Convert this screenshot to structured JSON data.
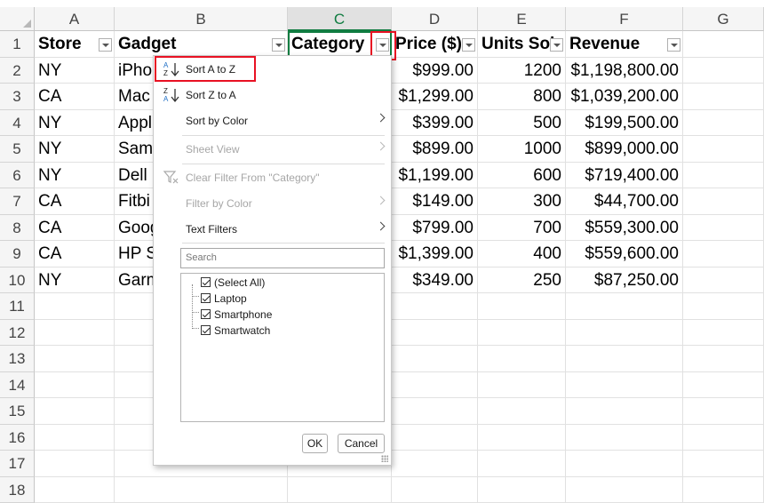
{
  "columns": [
    "A",
    "B",
    "C",
    "D",
    "E",
    "F",
    "G"
  ],
  "rows": [
    "1",
    "2",
    "3",
    "4",
    "5",
    "6",
    "7",
    "8",
    "9",
    "10",
    "11",
    "12",
    "13",
    "14",
    "15",
    "16",
    "17",
    "18"
  ],
  "headers": [
    "Store",
    "Gadget",
    "Category",
    "Price ($)",
    "Units Sol",
    "Revenue"
  ],
  "data": [
    {
      "store": "NY",
      "gadget": "iPho",
      "price": "$999.00",
      "units": "1200",
      "revenue": "$1,198,800.00"
    },
    {
      "store": "CA",
      "gadget": "Mac",
      "price": "$1,299.00",
      "units": "800",
      "revenue": "$1,039,200.00"
    },
    {
      "store": "NY",
      "gadget": "Appl",
      "price": "$399.00",
      "units": "500",
      "revenue": "$199,500.00"
    },
    {
      "store": "NY",
      "gadget": "Sams",
      "price": "$899.00",
      "units": "1000",
      "revenue": "$899,000.00"
    },
    {
      "store": "NY",
      "gadget": "Dell",
      "price": "$1,199.00",
      "units": "600",
      "revenue": "$719,400.00"
    },
    {
      "store": "CA",
      "gadget": "Fitbi",
      "price": "$149.00",
      "units": "300",
      "revenue": "$44,700.00"
    },
    {
      "store": "CA",
      "gadget": "Goog",
      "price": "$799.00",
      "units": "700",
      "revenue": "$559,300.00"
    },
    {
      "store": "CA",
      "gadget": "HP S",
      "price": "$1,399.00",
      "units": "400",
      "revenue": "$559,600.00"
    },
    {
      "store": "NY",
      "gadget": "Garm",
      "price": "$349.00",
      "units": "250",
      "revenue": "$87,250.00"
    }
  ],
  "menu": {
    "sort_az": "Sort A to Z",
    "sort_za": "Sort Z to A",
    "sort_color": "Sort by Color",
    "sheet_view": "Sheet View",
    "clear_filter": "Clear Filter From \"Category\"",
    "filter_color": "Filter by Color",
    "text_filters": "Text Filters",
    "search_placeholder": "Search",
    "list": [
      "(Select All)",
      "Laptop",
      "Smartphone",
      "Smartwatch"
    ],
    "ok": "OK",
    "cancel": "Cancel"
  },
  "colors": {
    "accent": "#107c41",
    "highlight": "#e81123"
  },
  "icons": {
    "sort_az": "sort-ascending-icon",
    "sort_za": "sort-descending-icon",
    "clear": "clear-filter-icon"
  }
}
